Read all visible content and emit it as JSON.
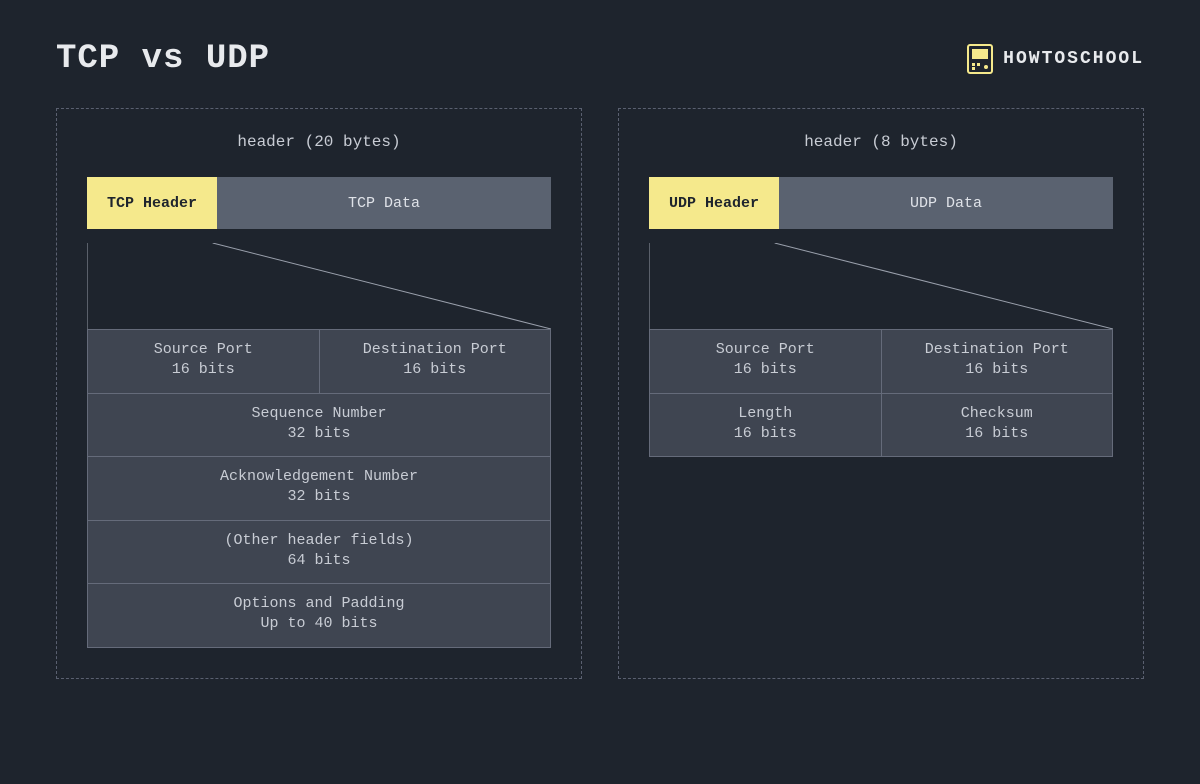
{
  "title": "TCP vs UDP",
  "brand": "HOWTOSCHOOL",
  "tcp": {
    "header_label": "header (20 bytes)",
    "seg_header": "TCP Header",
    "seg_data": "TCP Data",
    "rows": [
      [
        {
          "name": "Source Port",
          "bits": "16 bits"
        },
        {
          "name": "Destination Port",
          "bits": "16 bits"
        }
      ],
      [
        {
          "name": "Sequence Number",
          "bits": "32 bits"
        }
      ],
      [
        {
          "name": "Acknowledgement Number",
          "bits": "32 bits"
        }
      ],
      [
        {
          "name": "(Other header fields)",
          "bits": "64 bits"
        }
      ],
      [
        {
          "name": "Options and Padding",
          "bits": "Up to 40 bits"
        }
      ]
    ]
  },
  "udp": {
    "header_label": "header (8 bytes)",
    "seg_header": "UDP Header",
    "seg_data": "UDP Data",
    "rows": [
      [
        {
          "name": "Source Port",
          "bits": "16 bits"
        },
        {
          "name": "Destination Port",
          "bits": "16 bits"
        }
      ],
      [
        {
          "name": "Length",
          "bits": "16 bits"
        },
        {
          "name": "Checksum",
          "bits": "16 bits"
        }
      ]
    ]
  }
}
